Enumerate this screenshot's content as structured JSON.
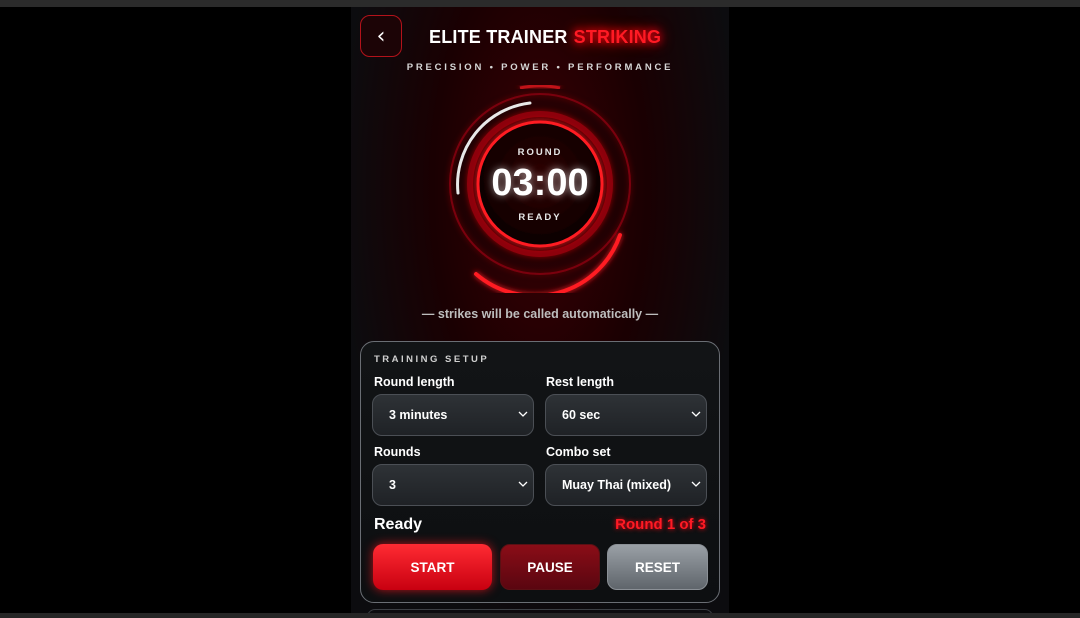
{
  "header": {
    "back_glyph": "‹",
    "title": "ELITE TRAINER",
    "title_accent": "STRIKING",
    "tagline": "PRECISION • POWER • PERFORMANCE"
  },
  "timer": {
    "label": "ROUND",
    "time": "03:00",
    "state": "READY"
  },
  "hint": "— strikes will be called automatically —",
  "setup": {
    "title": "TRAINING SETUP",
    "round_length": {
      "label": "Round length",
      "value": "3 minutes"
    },
    "rest_length": {
      "label": "Rest length",
      "value": "60 sec"
    },
    "rounds": {
      "label": "Rounds",
      "value": "3"
    },
    "combo_set": {
      "label": "Combo set",
      "value": "Muay Thai (mixed)"
    }
  },
  "status": {
    "text": "Ready",
    "round_counter": "Round 1 of 3"
  },
  "controls": {
    "start_label": "START",
    "pause_label": "PAUSE",
    "reset_label": "RESET"
  },
  "colors": {
    "accent_red": "#ff1a24",
    "background": "#000000",
    "panel_border": "#6a6e74"
  }
}
